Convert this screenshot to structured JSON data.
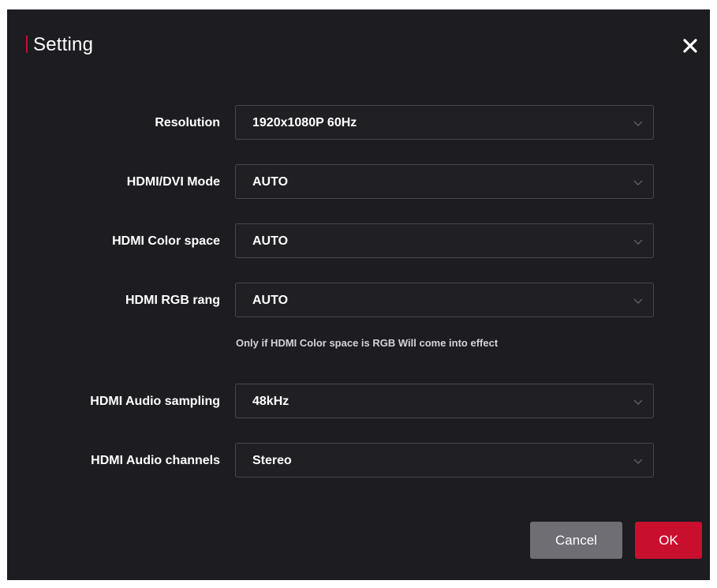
{
  "dialog": {
    "title": "Setting",
    "accent_color": "#c8102e",
    "close_icon": "close-icon"
  },
  "fields": [
    {
      "label": "Resolution",
      "value": "1920x1080P 60Hz"
    },
    {
      "label": "HDMI/DVI Mode",
      "value": "AUTO"
    },
    {
      "label": "HDMI Color space",
      "value": "AUTO"
    },
    {
      "label": "HDMI RGB rang",
      "value": "AUTO"
    },
    {
      "label": "HDMI Audio sampling",
      "value": "48kHz"
    },
    {
      "label": "HDMI Audio channels",
      "value": "Stereo"
    }
  ],
  "hint": "Only if HDMI Color space is RGB Will come into effect",
  "buttons": {
    "cancel": "Cancel",
    "ok": "OK"
  }
}
